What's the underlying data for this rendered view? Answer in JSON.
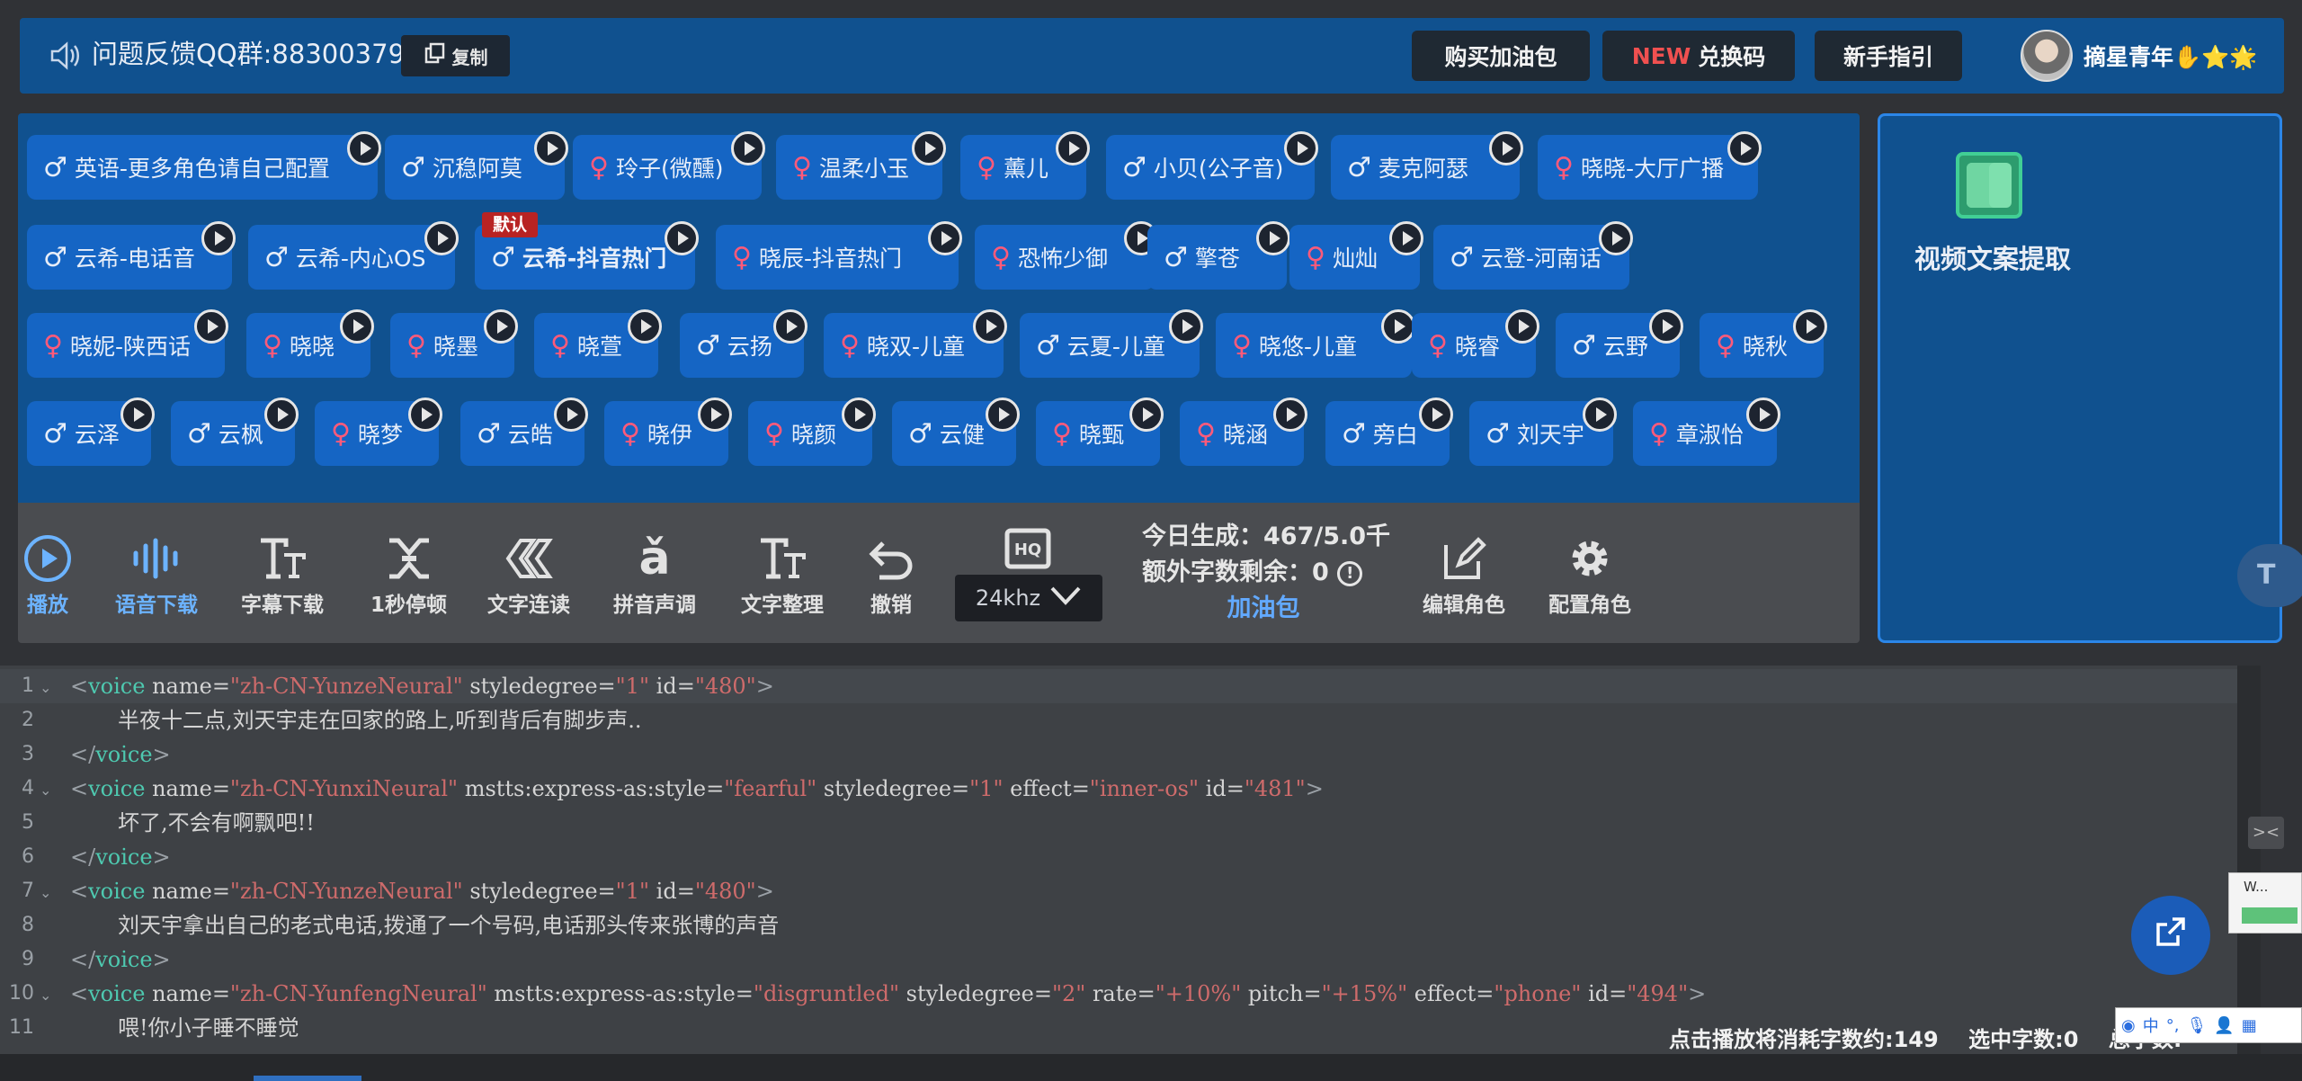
{
  "header": {
    "feedback_text": "问题反馈QQ群:88300379",
    "copy_label": "复制",
    "buy_button": "购买加油包",
    "redeem_new": "NEW",
    "redeem_label": "兑换码",
    "guide_button": "新手指引",
    "username": "摘星青年✋⭐🌟"
  },
  "default_badge": "默认",
  "voices": [
    {
      "label": "英语-更多角色请自己配置",
      "gender": "♂"
    },
    {
      "label": "沉稳阿莫",
      "gender": "♂"
    },
    {
      "label": "玲子(微醺)",
      "gender": "♀"
    },
    {
      "label": "温柔小玉",
      "gender": "♀"
    },
    {
      "label": "薰儿",
      "gender": "♀"
    },
    {
      "label": "小贝(公子音)",
      "gender": "♂"
    },
    {
      "label": "麦克阿瑟",
      "gender": "♂"
    },
    {
      "label": "晓晓-大厅广播",
      "gender": "♀"
    },
    {
      "label": "云希-电话音",
      "gender": "♂"
    },
    {
      "label": "云希-内心OS",
      "gender": "♂"
    },
    {
      "label": "云希-抖音热门",
      "gender": "♂"
    },
    {
      "label": "晓辰-抖音热门",
      "gender": "♀"
    },
    {
      "label": "恐怖少御",
      "gender": "♀"
    },
    {
      "label": "擎苍",
      "gender": "♂"
    },
    {
      "label": "灿灿",
      "gender": "♀"
    },
    {
      "label": "云登-河南话",
      "gender": "♂"
    },
    {
      "label": "晓妮-陕西话",
      "gender": "♀"
    },
    {
      "label": "晓晓",
      "gender": "♀"
    },
    {
      "label": "晓墨",
      "gender": "♀"
    },
    {
      "label": "晓萱",
      "gender": "♀"
    },
    {
      "label": "云扬",
      "gender": "♂"
    },
    {
      "label": "晓双-儿童",
      "gender": "♀"
    },
    {
      "label": "云夏-儿童",
      "gender": "♂"
    },
    {
      "label": "晓悠-儿童",
      "gender": "♀"
    },
    {
      "label": "晓睿",
      "gender": "♀"
    },
    {
      "label": "云野",
      "gender": "♂"
    },
    {
      "label": "晓秋",
      "gender": "♀"
    },
    {
      "label": "云泽",
      "gender": "♂"
    },
    {
      "label": "云枫",
      "gender": "♂"
    },
    {
      "label": "晓梦",
      "gender": "♀"
    },
    {
      "label": "云皓",
      "gender": "♂"
    },
    {
      "label": "晓伊",
      "gender": "♀"
    },
    {
      "label": "晓颜",
      "gender": "♀"
    },
    {
      "label": "云健",
      "gender": "♂"
    },
    {
      "label": "晓甄",
      "gender": "♀"
    },
    {
      "label": "晓涵",
      "gender": "♀"
    },
    {
      "label": "旁白",
      "gender": "♂"
    },
    {
      "label": "刘天宇",
      "gender": "♂"
    },
    {
      "label": "章淑怡",
      "gender": "♀"
    }
  ],
  "toolbar": {
    "play": "播放",
    "voice_download": "语音下载",
    "subtitle_download": "字幕下载",
    "pause_1s": "1秒停顿",
    "text_link": "文字连读",
    "pinyin_tone": "拼音声调",
    "text_tidy": "文字整理",
    "undo": "撤销",
    "sample_rate": "24khz",
    "today_generated": "今日生成：467/5.0千",
    "extra_remaining": "额外字数剩余：",
    "extra_count": "0",
    "oil_pack": "加油包",
    "edit_role": "编辑角色",
    "config_role": "配置角色"
  },
  "side_panel": {
    "label": "视频文案提取"
  },
  "editor": {
    "line_numbers": [
      "1",
      "2",
      "3",
      "4",
      "5",
      "6",
      "7",
      "8",
      "9",
      "10",
      "11"
    ],
    "lines": [
      "<voice name=\"zh-CN-YunzeNeural\" styledegree=\"1\" id=\"480\">",
      "半夜十二点,刘天宇走在回家的路上,听到背后有脚步声..",
      "</voice>",
      "<voice name=\"zh-CN-YunxiNeural\" mstts:express-as:style=\"fearful\" styledegree=\"1\" effect=\"inner-os\" id=\"481\">",
      "坏了,不会有啊飘吧!!",
      "</voice>",
      "<voice name=\"zh-CN-YunzeNeural\" styledegree=\"1\" id=\"480\">",
      "刘天宇拿出自己的老式电话,拨通了一个号码,电话那头传来张博的声音",
      "</voice>",
      "<voice name=\"zh-CN-YunfengNeural\" mstts:express-as:style=\"disgruntled\" styledegree=\"2\" rate=\"+10%\" pitch=\"+15%\" effect=\"phone\" id=\"494\">",
      "喂!你小子睡不睡觉"
    ]
  },
  "status": {
    "consume": "点击播放将消耗字数约:149",
    "selected": "选中字数:0",
    "total": "总字数:"
  },
  "widget": {
    "w_label": "W..."
  },
  "colors": {
    "panel_blue": "#10518f",
    "chip_blue": "#1565c4",
    "accent_blue": "#6cb3ff",
    "female_pink": "#ff5a7a",
    "tag_color": "#4ec9b0",
    "value_color": "#ce6b6b"
  }
}
